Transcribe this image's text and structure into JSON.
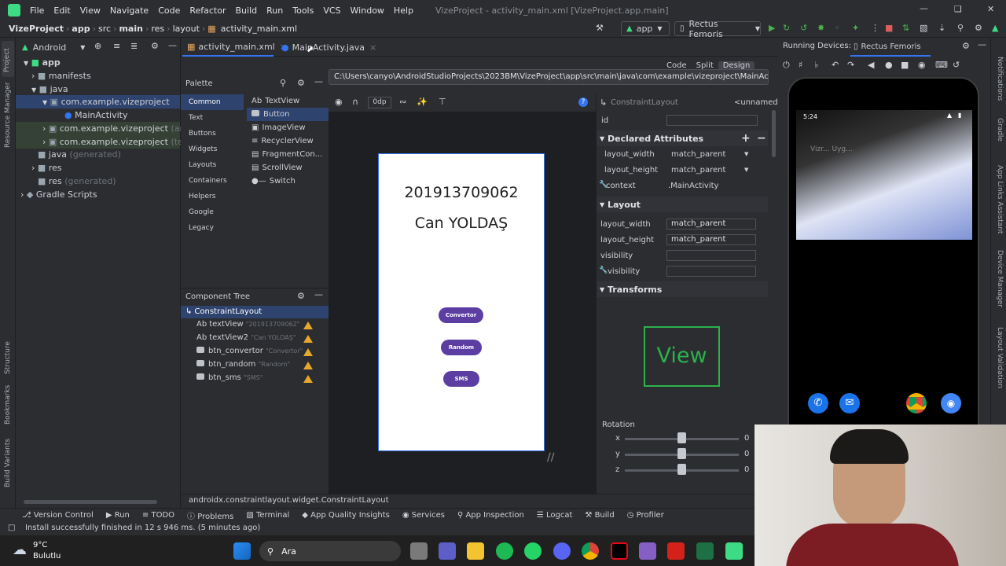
{
  "menu": [
    "File",
    "Edit",
    "View",
    "Navigate",
    "Code",
    "Refactor",
    "Build",
    "Run",
    "Tools",
    "VCS",
    "Window",
    "Help"
  ],
  "window_title": "VizeProject - activity_main.xml [VizeProject.app.main]",
  "breadcrumbs": [
    "VizeProject",
    "app",
    "src",
    "main",
    "res",
    "layout",
    "activity_main.xml"
  ],
  "toolbar": {
    "module": "app",
    "device": "Rectus Femoris"
  },
  "project_view": "Android",
  "project_tree": [
    {
      "label": "app",
      "level": 0
    },
    {
      "label": "manifests",
      "level": 1
    },
    {
      "label": "java",
      "level": 1
    },
    {
      "label": "com.example.vizeproject",
      "level": 2
    },
    {
      "label": "MainActivity",
      "level": 3
    },
    {
      "label": "com.example.vizeproject",
      "suffix": "(androi",
      "level": 2
    },
    {
      "label": "com.example.vizeproject",
      "suffix": "(test)",
      "level": 2
    },
    {
      "label": "java",
      "suffix": "(generated)",
      "level": 1
    },
    {
      "label": "res",
      "level": 1
    },
    {
      "label": "res",
      "suffix": "(generated)",
      "level": 1
    },
    {
      "label": "Gradle Scripts",
      "level": 0
    }
  ],
  "left_strip": [
    "Project",
    "Resource Manager",
    "Structure",
    "Bookmarks",
    "Build Variants"
  ],
  "tabs": [
    "activity_main.xml",
    "MainActivity.java"
  ],
  "tooltip_path": "C:\\Users\\canyo\\AndroidStudioProjects\\2023BM\\VizeProject\\app\\src\\main\\java\\com\\example\\vizeproject\\MainActivity.java",
  "view_modes": [
    "Code",
    "Split",
    "Design"
  ],
  "palette": {
    "title": "Palette",
    "categories": [
      "Common",
      "Text",
      "Buttons",
      "Widgets",
      "Layouts",
      "Containers",
      "Helpers",
      "Google",
      "Legacy"
    ],
    "items": [
      {
        "prefix": "Ab",
        "label": "TextView"
      },
      {
        "label": "Button"
      },
      {
        "label": "ImageView"
      },
      {
        "label": "RecyclerView"
      },
      {
        "label": "FragmentCon..."
      },
      {
        "label": "ScrollView"
      },
      {
        "label": "Switch"
      }
    ]
  },
  "component_tree": {
    "title": "Component Tree",
    "root": "ConstraintLayout",
    "items": [
      {
        "prefix": "Ab",
        "id": "textView",
        "hint": "\"201913709062\""
      },
      {
        "prefix": "Ab",
        "id": "textView2",
        "hint": "\"Can YOLDAŞ\""
      },
      {
        "id": "btn_convertor",
        "hint": "\"Convertor\""
      },
      {
        "id": "btn_random",
        "hint": "\"Random\""
      },
      {
        "id": "btn_sms",
        "hint": "\"SMS\""
      }
    ]
  },
  "design_toolbar": {
    "margin": "0dp"
  },
  "design_preview": {
    "number": "201913709062",
    "name": "Can YOLDAŞ",
    "buttons": [
      "Convertor",
      "Random",
      "SMS"
    ]
  },
  "attributes": {
    "header": "ConstraintLayout",
    "unnamed": "<unnamed>",
    "id_label": "id",
    "declared_title": "Declared Attributes",
    "declared": [
      {
        "name": "layout_width",
        "value": "match_parent"
      },
      {
        "name": "layout_height",
        "value": "match_parent"
      },
      {
        "name": "context",
        "value": ".MainActivity"
      }
    ],
    "layout_title": "Layout",
    "layout": [
      {
        "name": "layout_width",
        "value": "match_parent"
      },
      {
        "name": "layout_height",
        "value": "match_parent"
      },
      {
        "name": "visibility",
        "value": ""
      },
      {
        "name": "visibility",
        "value": ""
      }
    ],
    "transforms_title": "Transforms",
    "view_text": "View",
    "rotation_label": "Rotation",
    "axes": [
      {
        "name": "x",
        "value": "0"
      },
      {
        "name": "y",
        "value": "0"
      },
      {
        "name": "z",
        "value": "0"
      }
    ]
  },
  "running_devices": {
    "label": "Running Devices:",
    "device_tab": "Rectus Femoris",
    "time": "5:24",
    "app_caption": "Vizr... Uyg..."
  },
  "right_strip": [
    "Notifications",
    "Gradle",
    "App Links Assistant",
    "Device Manager",
    "Layout Validation"
  ],
  "design_footer": "androidx.constraintlayout.widget.ConstraintLayout",
  "bottom_tools": [
    "Version Control",
    "Run",
    "TODO",
    "Problems",
    "Terminal",
    "App Quality Insights",
    "Services",
    "App Inspection",
    "Logcat",
    "Build",
    "Profiler"
  ],
  "status_message": "Install successfully finished in 12 s 946 ms. (5 minutes ago)",
  "weather": {
    "temp": "9°C",
    "desc": "Bulutlu"
  },
  "search_label": "Ara",
  "colors": {
    "accent": "#3574f0",
    "button": "#5c3ea3",
    "warning": "#e5a72d",
    "selection": "#2e436e",
    "view_green": "#2bb24c"
  }
}
